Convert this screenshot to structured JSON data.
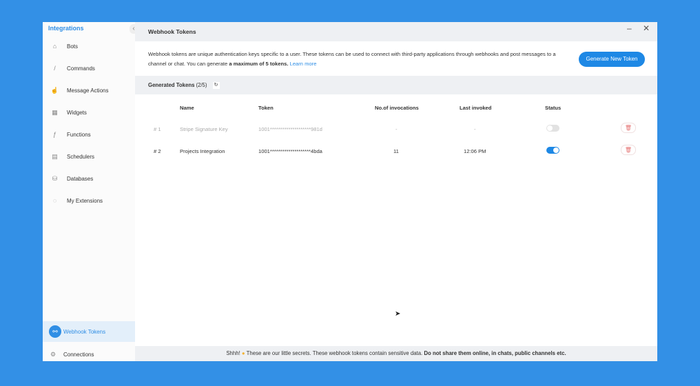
{
  "sidebar": {
    "title": "Integrations",
    "items": [
      {
        "label": "Bots",
        "icon": "bot-icon"
      },
      {
        "label": "Commands",
        "icon": "slash-icon"
      },
      {
        "label": "Message Actions",
        "icon": "hand-icon"
      },
      {
        "label": "Widgets",
        "icon": "grid-icon"
      },
      {
        "label": "Functions",
        "icon": "function-icon"
      },
      {
        "label": "Schedulers",
        "icon": "calendar-icon"
      },
      {
        "label": "Databases",
        "icon": "database-icon"
      },
      {
        "label": "My Extensions",
        "icon": "extension-icon"
      }
    ],
    "active": {
      "label": "Webhook Tokens",
      "icon": "webhook-icon"
    },
    "connections": {
      "label": "Connections",
      "icon": "gear-icon"
    }
  },
  "header": {
    "title": "Webhook Tokens"
  },
  "description": {
    "text1": "Webhook tokens are unique authentication keys specific to a user. These tokens can be used to connect with third-party applications through webhooks and post messages to a channel or chat. You can generate ",
    "bold": "a maximum of 5 tokens.",
    "link": "Learn more"
  },
  "generate_button": "Generate New Token",
  "tokens_bar": {
    "label": "Generated Tokens",
    "count": "(2/5)"
  },
  "table": {
    "headers": [
      "Name",
      "Token",
      "No.of invocations",
      "Last invoked",
      "Status"
    ],
    "rows": [
      {
        "index": "# 1",
        "name": "Stripe Signature Key",
        "token": "1001********************981d",
        "invocations": "-",
        "last": "-",
        "enabled": false
      },
      {
        "index": "# 2",
        "name": "Projects Integration",
        "token": "1001********************4bda",
        "invocations": "11",
        "last": "12:06 PM",
        "enabled": true
      }
    ]
  },
  "footer": {
    "text1": "Shhh! ",
    "text2": " These are our little secrets. These webhook tokens contain sensitive data. ",
    "bold": "Do not share them online, in chats, public channels etc."
  },
  "colors": {
    "accent": "#1e88e5",
    "background": "#3390e6"
  }
}
